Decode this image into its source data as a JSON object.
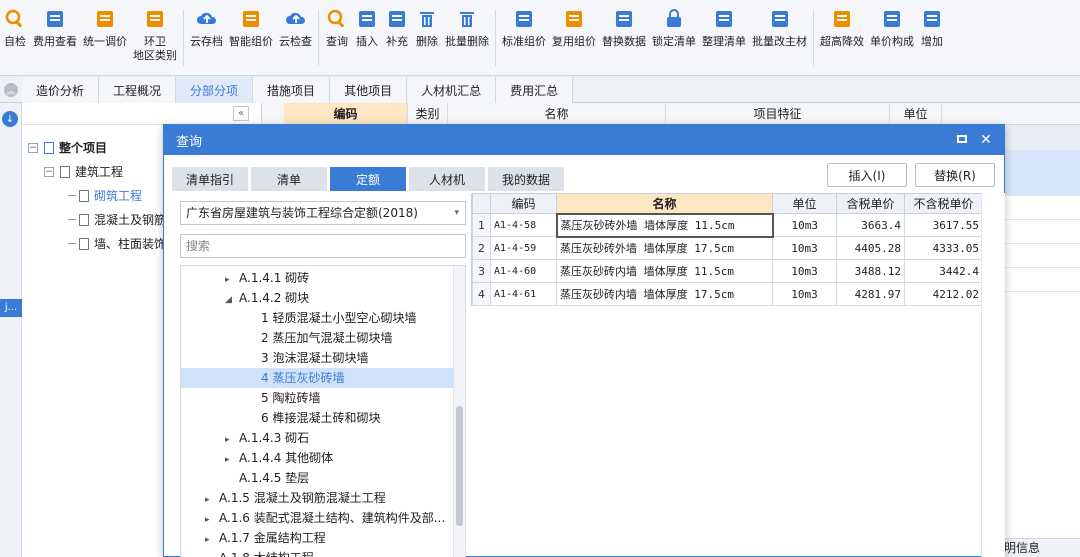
{
  "toolbar": {
    "items": [
      {
        "label": "自检",
        "icon": "check-icon",
        "color": "#f08c00"
      },
      {
        "label": "费用查看",
        "icon": "cost-view-icon",
        "color": "#3a7bd5"
      },
      {
        "label": "统一调价",
        "icon": "adjust-price-icon",
        "color": "#f08c00"
      },
      {
        "label": "环卫\n地区类别",
        "icon": "region-icon",
        "color": "#f08c00"
      },
      {
        "label": "云存档",
        "icon": "cloud-save-icon",
        "color": "#3a7bd5"
      },
      {
        "label": "智能组价",
        "icon": "smart-price-icon",
        "color": "#f08c00"
      },
      {
        "label": "云检查",
        "icon": "cloud-check-icon",
        "color": "#3a7bd5"
      },
      {
        "label": "查询",
        "icon": "query-icon",
        "color": "#f08c00"
      },
      {
        "label": "插入",
        "icon": "insert-icon",
        "color": "#3a7bd5"
      },
      {
        "label": "补充",
        "icon": "supplement-icon",
        "color": "#3a7bd5"
      },
      {
        "label": "删除",
        "icon": "delete-icon",
        "color": "#3a7bd5"
      },
      {
        "label": "批量删除",
        "icon": "batch-delete-icon",
        "color": "#3a7bd5"
      },
      {
        "label": "标准组价",
        "icon": "standard-price-icon",
        "color": "#3a7bd5"
      },
      {
        "label": "复用组价",
        "icon": "reuse-price-icon",
        "color": "#f08c00"
      },
      {
        "label": "替换数据",
        "icon": "replace-data-icon",
        "color": "#3a7bd5"
      },
      {
        "label": "锁定清单",
        "icon": "lock-icon",
        "color": "#3a7bd5"
      },
      {
        "label": "整理清单",
        "icon": "organize-icon",
        "color": "#3a7bd5"
      },
      {
        "label": "批量改主材",
        "icon": "batch-material-icon",
        "color": "#3a7bd5"
      },
      {
        "label": "超高降效",
        "icon": "height-icon",
        "color": "#f08c00"
      },
      {
        "label": "单价构成",
        "icon": "unit-price-icon",
        "color": "#3a7bd5"
      },
      {
        "label": "增加",
        "icon": "add-icon",
        "color": "#3a7bd5"
      }
    ]
  },
  "main_tabs": [
    "造价分析",
    "工程概况",
    "分部分项",
    "措施项目",
    "其他项目",
    "人材机汇总",
    "费用汇总"
  ],
  "main_tabs_active": 2,
  "left_tree": {
    "collapse_label": "«",
    "root": "整个项目",
    "child": "建筑工程",
    "items": [
      "砌筑工程",
      "混凝土及钢筋",
      "墙、柱面装饰"
    ],
    "selected_index": 0,
    "left_fragment": "j..."
  },
  "bg_table_headers": [
    "编码",
    "类别",
    "名称",
    "项目特征",
    "单位"
  ],
  "bg_bottom_tab": "明信息",
  "dialog": {
    "title": "查询",
    "tabs": [
      "清单指引",
      "清单",
      "定额",
      "人材机",
      "我的数据"
    ],
    "active_tab": 2,
    "insert_button": "插入(I)",
    "replace_button": "替换(R)",
    "dropdown_value": "广东省房屋建筑与装饰工程综合定额(2018)",
    "search_placeholder": "搜索",
    "tree": [
      {
        "label": "A.1.4.1 砌砖",
        "arrow": "▸",
        "indent": 2
      },
      {
        "label": "A.1.4.2 砌块",
        "arrow": "◢",
        "indent": 2
      },
      {
        "label": "1 轻质混凝土小型空心砌块墙",
        "arrow": "",
        "indent": 3
      },
      {
        "label": "2 蒸压加气混凝土砌块墙",
        "arrow": "",
        "indent": 3
      },
      {
        "label": "3 泡沫混凝土砌块墙",
        "arrow": "",
        "indent": 3
      },
      {
        "label": "4 蒸压灰砂砖墙",
        "arrow": "",
        "indent": 3,
        "selected": true
      },
      {
        "label": "5 陶粒砖墙",
        "arrow": "",
        "indent": 3
      },
      {
        "label": "6 榫接混凝土砖和砌块",
        "arrow": "",
        "indent": 3
      },
      {
        "label": "A.1.4.3 砌石",
        "arrow": "▸",
        "indent": 2
      },
      {
        "label": "A.1.4.4 其他砌体",
        "arrow": "▸",
        "indent": 2
      },
      {
        "label": "A.1.4.5 垫层",
        "arrow": "",
        "indent": 2
      },
      {
        "label": "A.1.5 混凝土及钢筋混凝土工程",
        "arrow": "▸",
        "indent": 1
      },
      {
        "label": "A.1.6 装配式混凝土结构、建筑构件及部...",
        "arrow": "▸",
        "indent": 1
      },
      {
        "label": "A.1.7 金属结构工程",
        "arrow": "▸",
        "indent": 1
      },
      {
        "label": "A.1.8 木结构工程",
        "arrow": "▸",
        "indent": 1
      }
    ],
    "grid": {
      "headers": [
        "",
        "编码",
        "名称",
        "单位",
        "含税单价",
        "不含税单价"
      ],
      "rows": [
        {
          "idx": "1",
          "code": "A1-4-58",
          "name": "蒸压灰砂砖外墙 墙体厚度 11.5cm",
          "unit": "10m3",
          "tax_price": "3663.4",
          "notax_price": "3617.55"
        },
        {
          "idx": "2",
          "code": "A1-4-59",
          "name": "蒸压灰砂砖外墙 墙体厚度 17.5cm",
          "unit": "10m3",
          "tax_price": "4405.28",
          "notax_price": "4333.05"
        },
        {
          "idx": "3",
          "code": "A1-4-60",
          "name": "蒸压灰砂砖内墙 墙体厚度 11.5cm",
          "unit": "10m3",
          "tax_price": "3488.12",
          "notax_price": "3442.4"
        },
        {
          "idx": "4",
          "code": "A1-4-61",
          "name": "蒸压灰砂砖内墙 墙体厚度 17.5cm",
          "unit": "10m3",
          "tax_price": "4281.97",
          "notax_price": "4212.02"
        }
      ]
    }
  },
  "colors": {
    "accent": "#3a7bd5",
    "orange": "#f08c00",
    "selected_bg": "#cfe2fa",
    "header_hl": "#fde6c2"
  }
}
